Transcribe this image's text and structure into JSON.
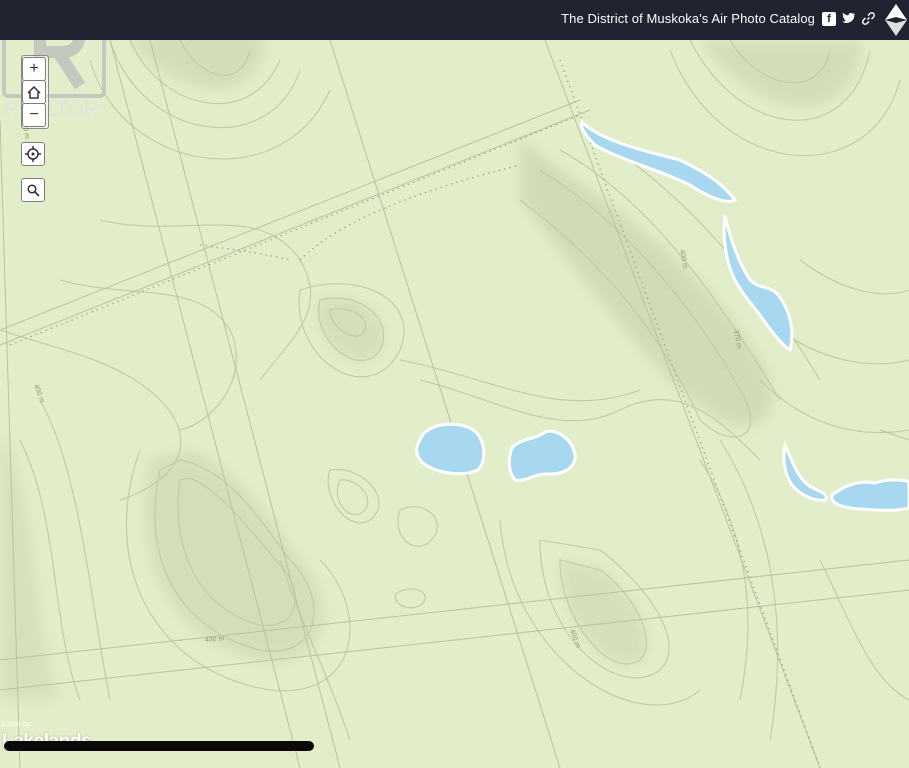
{
  "header": {
    "title": "The District of Muskoka's Air Photo Catalog",
    "facebook_icon": "facebook-icon",
    "twitter_icon": "twitter-icon",
    "link_icon": "link-icon",
    "compass_icon": "north-arrow-icon"
  },
  "watermark": {
    "brand": "REALTOR",
    "registered": "®",
    "brand_color": "#b8b8b8"
  },
  "map_controls": {
    "zoom_in": "+",
    "home_icon": "home-icon",
    "zoom_out": "−",
    "locate_icon": "locate-icon",
    "search_icon": "search-icon"
  },
  "contour_labels": {
    "a": "400 m",
    "b": "400 m",
    "c": "400 m",
    "d": "400 m",
    "e": "370 m",
    "f": "400 m",
    "g": "400 m"
  },
  "footer": {
    "listed_by": "Listed by:",
    "brokerage": "Lakelands"
  },
  "colors": {
    "land": "#e2edc9",
    "contour": "#c3cfa6",
    "water": "#a8d8ef",
    "header_bg": "#1f2430"
  }
}
